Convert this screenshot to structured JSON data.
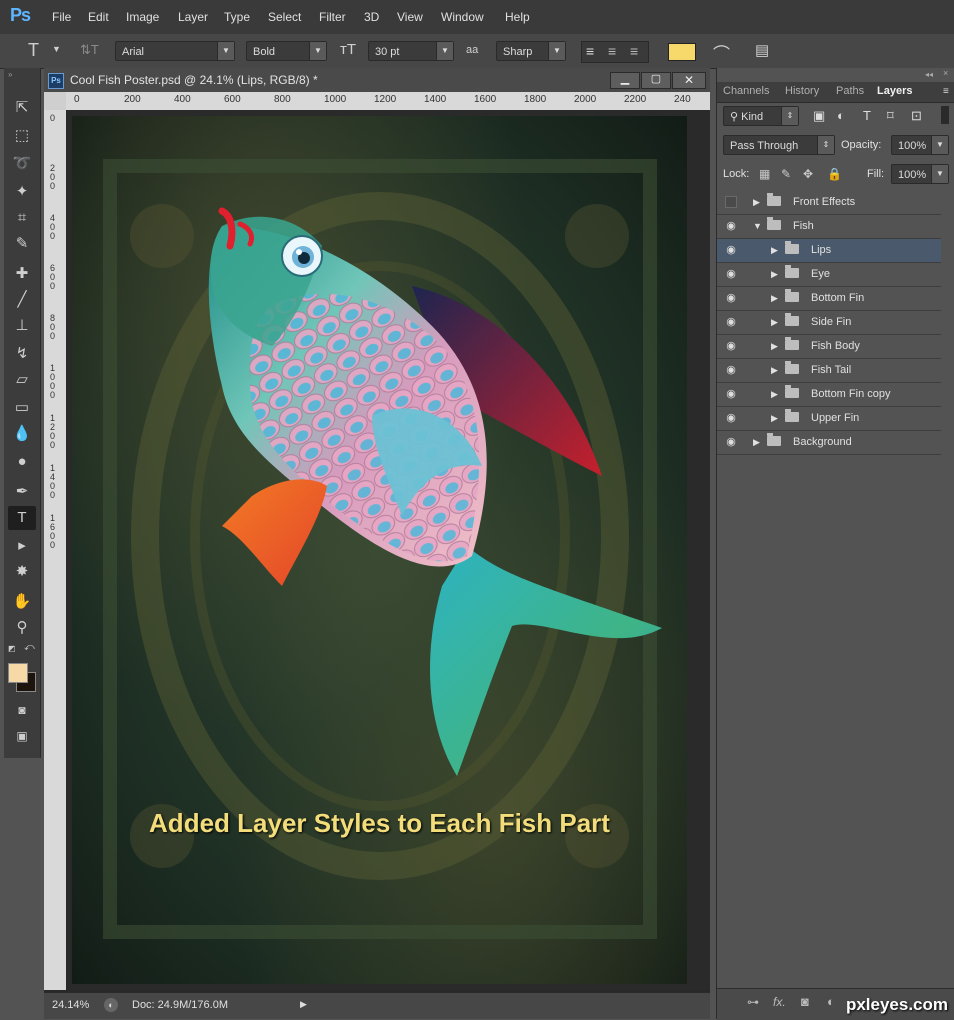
{
  "app": {
    "logo": "Ps"
  },
  "menu": [
    "File",
    "Edit",
    "Image",
    "Layer",
    "Type",
    "Select",
    "Filter",
    "3D",
    "View",
    "Window",
    "Help"
  ],
  "options": {
    "tool_glyph": "T",
    "font_family": "Arial",
    "font_style": "Bold",
    "font_size": "30 pt",
    "aa_label": "aa",
    "antialias": "Sharp",
    "text_color": "#f6d86b"
  },
  "document": {
    "title": "Cool Fish Poster.psd @ 24.1% (Lips, RGB/8) *",
    "ruler_h": [
      "0",
      "200",
      "400",
      "600",
      "800",
      "1000",
      "1200",
      "1400",
      "1600",
      "1800",
      "2000",
      "2200",
      "240"
    ],
    "ruler_v": [
      "0",
      "2\n0\n0",
      "4\n0\n0",
      "6\n0\n0",
      "8\n0\n0",
      "1\n0\n0\n0",
      "1\n2\n0\n0",
      "1\n4\n0\n0",
      "1\n6\n0\n0"
    ],
    "caption": "Added Layer Styles to Each Fish Part",
    "zoom": "24.14%",
    "doc_info": "Doc: 24.9M/176.0M"
  },
  "panel": {
    "tabs": [
      "Channels",
      "History",
      "Paths",
      "Layers"
    ],
    "active_tab": "Layers",
    "filter_kind": "Kind",
    "blend_mode": "Pass Through",
    "opacity_label": "Opacity:",
    "opacity": "100%",
    "lock_label": "Lock:",
    "fill_label": "Fill:",
    "fill": "100%",
    "layers": [
      {
        "name": "Front Effects",
        "visible": false,
        "indent": 0,
        "expanded": false,
        "selected": false
      },
      {
        "name": "Fish",
        "visible": true,
        "indent": 0,
        "expanded": true,
        "selected": false
      },
      {
        "name": "Lips",
        "visible": true,
        "indent": 1,
        "expanded": false,
        "selected": true
      },
      {
        "name": "Eye",
        "visible": true,
        "indent": 1,
        "expanded": false,
        "selected": false
      },
      {
        "name": "Bottom Fin",
        "visible": true,
        "indent": 1,
        "expanded": false,
        "selected": false
      },
      {
        "name": "Side Fin",
        "visible": true,
        "indent": 1,
        "expanded": false,
        "selected": false
      },
      {
        "name": "Fish Body",
        "visible": true,
        "indent": 1,
        "expanded": false,
        "selected": false
      },
      {
        "name": "Fish Tail",
        "visible": true,
        "indent": 1,
        "expanded": false,
        "selected": false
      },
      {
        "name": "Bottom Fin copy",
        "visible": true,
        "indent": 1,
        "expanded": false,
        "selected": false
      },
      {
        "name": "Upper Fin",
        "visible": true,
        "indent": 1,
        "expanded": false,
        "selected": false
      },
      {
        "name": "Background",
        "visible": true,
        "indent": 0,
        "expanded": false,
        "selected": false
      }
    ],
    "footer_icons": [
      "link-icon",
      "fx-icon",
      "mask-icon",
      "adjustment-icon",
      "group-icon",
      "new-layer-icon",
      "trash-icon"
    ],
    "footer_fx": "fx."
  },
  "colors": {
    "foreground": "#f6d9a6",
    "background": "#1e140e"
  },
  "watermark": "pxleyes.com"
}
